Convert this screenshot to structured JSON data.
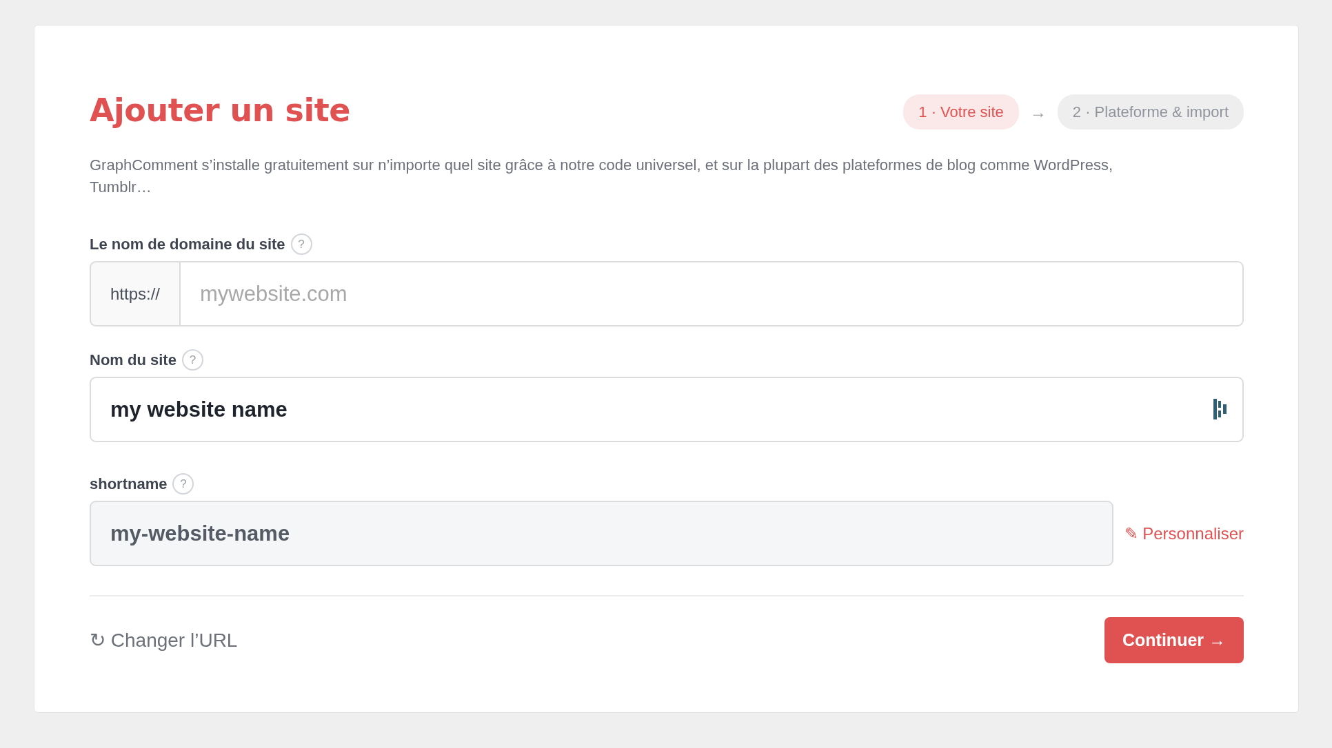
{
  "title": "Ajouter un site",
  "steps": [
    {
      "label": "1 · Votre site",
      "selected": true
    },
    {
      "label": "2 · Plateforme & import",
      "selected": false
    }
  ],
  "step_separator": "→",
  "description": "GraphComment s’installe gratuitement sur n’importe quel site grâce à notre code universel, et sur la plupart des plateformes de blog comme WordPress, Tumblr…",
  "fields": [
    {
      "kind": "prefixed",
      "label": "Le nom de domaine du site",
      "help": "?",
      "prefix": "https://",
      "placeholder": "mywebsite.com"
    },
    {
      "kind": "icon",
      "label": "Nom du site",
      "help": "?",
      "value": "my website name"
    },
    {
      "kind": "readonly",
      "label": "shortname",
      "help": "?",
      "value": "my-website-name",
      "action_icon": "✎",
      "action": "Personnaliser"
    }
  ],
  "footer": {
    "link_icon": "↻",
    "link": "Changer l’URL",
    "button": "Continuer →"
  }
}
